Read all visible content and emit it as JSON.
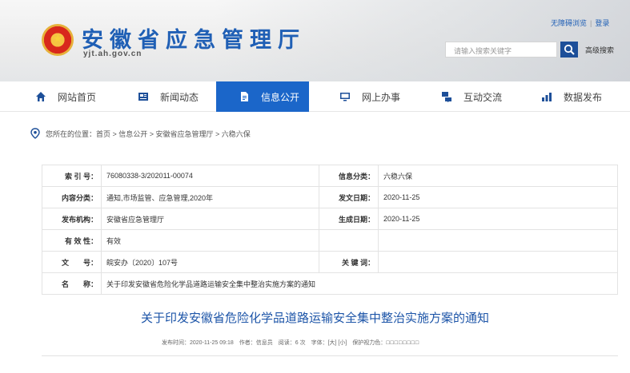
{
  "header": {
    "site_title": "安徽省应急管理厅",
    "domain": "yjt.ah.gov.cn",
    "top_links": [
      "无障碍浏览",
      "登录"
    ],
    "search": {
      "placeholder": "请输入搜索关键字"
    },
    "advanced_search": "高级搜索"
  },
  "nav": {
    "items": [
      {
        "label": "网站首页",
        "icon": "home-icon"
      },
      {
        "label": "新闻动态",
        "icon": "newspaper-icon"
      },
      {
        "label": "信息公开",
        "icon": "document-icon",
        "active": true
      },
      {
        "label": "网上办事",
        "icon": "monitor-icon"
      },
      {
        "label": "互动交流",
        "icon": "chat-icon"
      },
      {
        "label": "数据发布",
        "icon": "chart-icon"
      }
    ]
  },
  "breadcrumb": {
    "prefix": "您所在的位置：",
    "path": "首页 > 信息公开 > 安徽省应急管理厅 > 六稳六保"
  },
  "info_table": {
    "index_label": "索 引 号：",
    "index_value": "76080338-3/202011-00074",
    "category_label": "信息分类：",
    "category_value": "六稳六保",
    "content_label": "内容分类：",
    "content_value": "通知,市场监管、应急管理,2020年",
    "date_label": "发文日期：",
    "date_value": "2020-11-25",
    "org_label": "发布机构：",
    "org_value": "安徽省应急管理厅",
    "gen_label": "生成日期：",
    "gen_value": "2020-11-25",
    "validity_label": "有 效 性：",
    "validity_value": "有效",
    "docno_label": "文　　号：",
    "docno_value": "皖安办〔2020〕107号",
    "keywords_label": "关 键 词：",
    "keywords_value": "",
    "name_label": "名　　称：",
    "name_value": "关于印发安徽省危险化学品道路运输安全集中整治实施方案的通知"
  },
  "article": {
    "title": "关于印发安徽省危险化学品道路运输安全集中整治实施方案的通知",
    "meta": "发布时间：2020-11-25 09:18　作者：信息员　阅读：6 次　字体：[大] [小]　保护视力色：",
    "meta_boxes": "□□□□□□□□"
  },
  "colors": {
    "brand_blue": "#1f5fb5",
    "nav_active": "#1b66c9",
    "title_blue": "#1d55a8"
  }
}
